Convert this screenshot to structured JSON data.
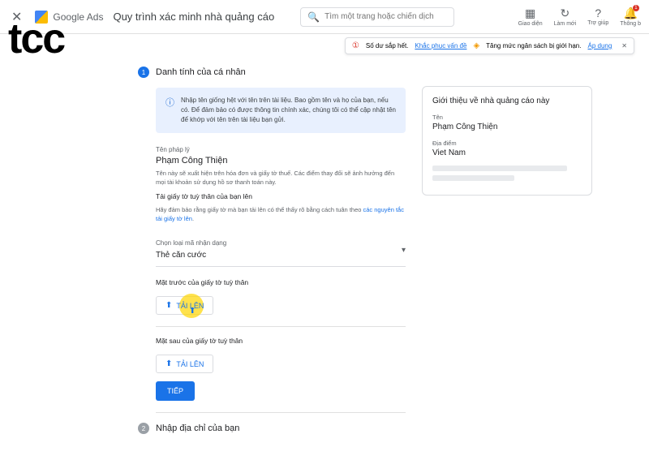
{
  "header": {
    "brand": "Google Ads",
    "title": "Quy trình xác minh nhà quảng cáo",
    "search_placeholder": "Tìm một trang hoặc chiến dịch",
    "actions": {
      "appearance": "Giao diện",
      "refresh": "Làm mới",
      "help": "Trợ giúp",
      "notifications": "Thông b",
      "notif_count": "1"
    }
  },
  "alerts": {
    "balance_text": "Số dư sắp hết.",
    "balance_link": "Khắc phục vấn đề",
    "budget_text": "Tăng mức ngân sách bị giới hạn.",
    "budget_link": "Áp dụng"
  },
  "step1": {
    "title": "Danh tính của cá nhân",
    "info": "Nhập tên giống hệt với tên trên tài liệu. Bao gồm tên và họ của bạn, nếu có. Để đảm bảo có được thông tin chính xác, chúng tôi có thể cập nhật tên để khớp với tên trên tài liệu bạn gửi.",
    "legal_name_label": "Tên pháp lý",
    "legal_name_value": "Phạm Công Thiện",
    "legal_name_desc": "Tên này sẽ xuất hiện trên hóa đơn và giấy tờ thuế. Các điểm thay đổi sẽ ảnh hưởng đến mọi tài khoản sử dụng hồ sơ thanh toán này.",
    "upload_title": "Tải giấy tờ tuỳ thân của bạn lên",
    "upload_desc_1": "Hãy đảm bảo rằng giấy tờ mà bạn tải lên có thể thấy rõ bằng cách tuân theo ",
    "upload_desc_link": "các nguyên tắc tải giấy tờ lên",
    "id_type_label": "Chọn loại mã nhận dạng",
    "id_type_value": "Thẻ căn cước",
    "front_label": "Mặt trước của giấy tờ tuỳ thân",
    "back_label": "Mặt sau của giấy tờ tuỳ thân",
    "upload_btn": "TẢI LÊN",
    "continue_btn": "TIẾP"
  },
  "step2": {
    "title": "Nhập địa chỉ của bạn"
  },
  "side": {
    "title": "Giới thiệu về nhà quảng cáo này",
    "name_label": "Tên",
    "name_value": "Phạm Công Thiện",
    "location_label": "Địa điểm",
    "location_value": "Viet Nam"
  },
  "watermark": "tcc"
}
